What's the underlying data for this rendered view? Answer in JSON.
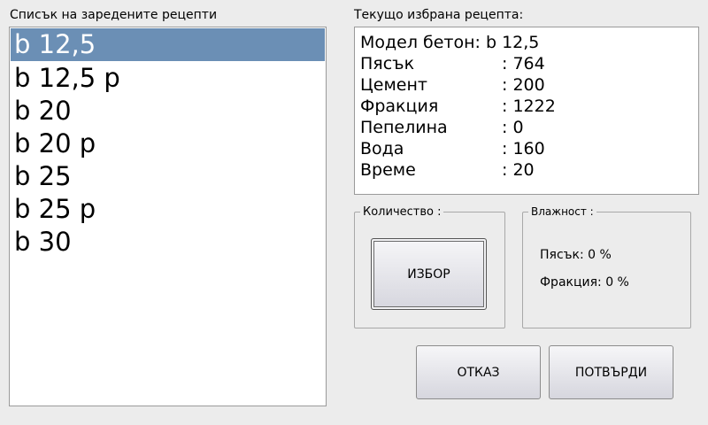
{
  "left_panel": {
    "title": "Списък на заредените рецепти",
    "items": [
      {
        "label": "b 12,5",
        "selected": true
      },
      {
        "label": "b 12,5 p",
        "selected": false
      },
      {
        "label": "b 20",
        "selected": false
      },
      {
        "label": "b 20 p",
        "selected": false
      },
      {
        "label": "b 25",
        "selected": false
      },
      {
        "label": "b 25 p",
        "selected": false
      },
      {
        "label": "b 30",
        "selected": false
      }
    ],
    "selected_color": "#6b8fb5"
  },
  "details": {
    "title": "Текущо избрана рецепта:",
    "model_line": "Модел бетон: b 12,5",
    "rows": [
      {
        "label": "Пясък",
        "value": ": 764"
      },
      {
        "label": "Цемент",
        "value": ": 200"
      },
      {
        "label": "Фракция",
        "value": ": 1222"
      },
      {
        "label": "Пепелина",
        "value": ": 0"
      },
      {
        "label": "Вода",
        "value": ": 160"
      },
      {
        "label": "Време",
        "value": ": 20"
      }
    ]
  },
  "quantity": {
    "legend": "Количество :",
    "select_button": "ИЗБОР"
  },
  "humidity": {
    "legend": "Влажност :",
    "sand_line": "Пясък: 0 %",
    "fraction_line": "Фракция: 0 %"
  },
  "actions": {
    "cancel": "ОТКАЗ",
    "confirm": "ПОТВЪРДИ"
  }
}
